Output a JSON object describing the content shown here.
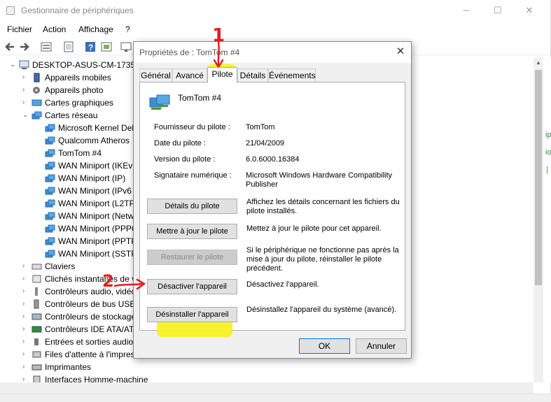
{
  "window": {
    "title": "Gestionnaire de périphériques",
    "controls": [
      "─",
      "☐",
      "✕"
    ]
  },
  "menu": [
    "Fichier",
    "Action",
    "Affichage",
    "?"
  ],
  "tree": {
    "root": "DESKTOP-ASUS-CM-1735",
    "items": [
      {
        "label": "Appareils mobiles",
        "icon": "mobile-icon"
      },
      {
        "label": "Appareils photo",
        "icon": "camera-icon"
      },
      {
        "label": "Cartes graphiques",
        "icon": "display-adapter-icon"
      },
      {
        "label": "Cartes réseau",
        "icon": "network-adapter-icon",
        "expanded": true
      },
      {
        "label": "Microsoft Kernel Deb",
        "icon": "network-adapter-icon",
        "child": true
      },
      {
        "label": "Qualcomm Atheros",
        "icon": "network-adapter-icon",
        "child": true
      },
      {
        "label": "TomTom #4",
        "icon": "network-adapter-icon",
        "child": true
      },
      {
        "label": "WAN Miniport (IKEv",
        "icon": "network-adapter-icon",
        "child": true
      },
      {
        "label": "WAN Miniport (IP)",
        "icon": "network-adapter-icon",
        "child": true
      },
      {
        "label": "WAN Miniport (IPv6",
        "icon": "network-adapter-icon",
        "child": true
      },
      {
        "label": "WAN Miniport (L2TP",
        "icon": "network-adapter-icon",
        "child": true
      },
      {
        "label": "WAN Miniport (Netw",
        "icon": "network-adapter-icon",
        "child": true
      },
      {
        "label": "WAN Miniport (PPPO",
        "icon": "network-adapter-icon",
        "child": true
      },
      {
        "label": "WAN Miniport (PPTP",
        "icon": "network-adapter-icon",
        "child": true
      },
      {
        "label": "WAN Miniport (SSTP",
        "icon": "network-adapter-icon",
        "child": true
      },
      {
        "label": "Claviers",
        "icon": "keyboard-icon"
      },
      {
        "label": "Clichés instantanés de v",
        "icon": "snapshot-icon"
      },
      {
        "label": "Contrôleurs audio, vidéo",
        "icon": "audio-icon"
      },
      {
        "label": "Contrôleurs de bus USB",
        "icon": "usb-icon"
      },
      {
        "label": "Contrôleurs de stockage",
        "icon": "storage-icon"
      },
      {
        "label": "Contrôleurs IDE ATA/ATA",
        "icon": "ide-icon"
      },
      {
        "label": "Entrées et sorties audio",
        "icon": "speaker-icon"
      },
      {
        "label": "Files d'attente à l'impres",
        "icon": "print-queue-icon"
      },
      {
        "label": "Imprimantes",
        "icon": "printer-icon"
      },
      {
        "label": "Interfaces Homme-machine",
        "icon": "hid-icon"
      }
    ]
  },
  "right_fragments": [
    "ip",
    "io",
    "|"
  ],
  "dialog": {
    "title": "Propriétés de : TomTom #4",
    "tabs": [
      "Général",
      "Avancé",
      "Pilote",
      "Détails",
      "Événements"
    ],
    "active_tab": "Pilote",
    "device_name": "TomTom #4",
    "fields": [
      {
        "label": "Fournisseur du pilote :",
        "value": "TomTom"
      },
      {
        "label": "Date du pilote :",
        "value": "21/04/2009"
      },
      {
        "label": "Version du pilote :",
        "value": "6.0.6000.16384"
      },
      {
        "label": "Signataire numérique :",
        "value": "Microsoft Windows Hardware Compatibility Publisher"
      }
    ],
    "actions": [
      {
        "button": "Détails du pilote",
        "desc": "Affichez les détails concernant les fichiers du pilote installés."
      },
      {
        "button": "Mettre à jour le pilote",
        "desc": "Mettez à jour le pilote pour cet appareil."
      },
      {
        "button": "Restaurer le pilote",
        "desc": "Si le périphérique ne fonctionne pas après la mise à jour du pilote, réinstaller le pilote précédent.",
        "disabled": true
      },
      {
        "button": "Désactiver l'appareil",
        "desc": "Désactivez l'appareil."
      },
      {
        "button": "Désinstaller l'appareil",
        "desc": "Désinstallez l'appareil du système (avancé)."
      }
    ],
    "ok": "OK",
    "cancel": "Annuler"
  },
  "annotations": {
    "step1": "1",
    "step2": "2",
    "color": "#e02020",
    "highlight": "#f6f21a"
  }
}
